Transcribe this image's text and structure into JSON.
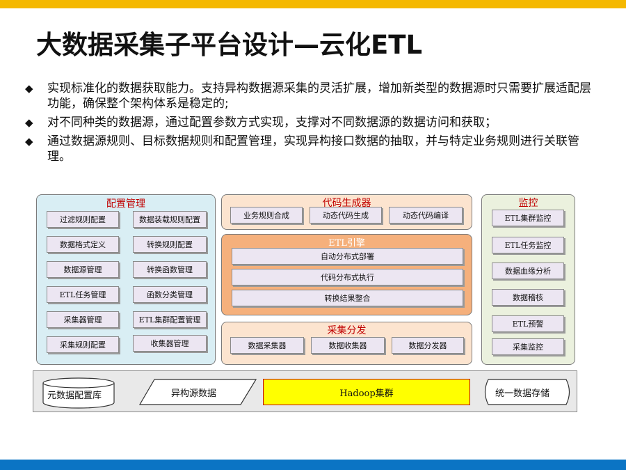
{
  "title": "大数据采集子平台设计—云化ETL",
  "bullets": [
    "实现标准化的数据获取能力。支持异构数据源采集的灵活扩展，增加新类型的数据源时只需要扩展适配层功能，确保整个架构体系是稳定的;",
    "对不同种类的数据源，通过配置参数方式实现，支撑对不同数据源的数据访问和获取；",
    "通过数据源规则、目标数据规则和配置管理，实现异构接口数据的抽取，并与特定业务规则进行关联管理。"
  ],
  "bullet_glyph": "◆",
  "diagram": {
    "config": {
      "title": "配置管理",
      "items": [
        "过滤规则配置",
        "数据装载规则配置",
        "数据格式定义",
        "转换规则配置",
        "数据源管理",
        "转换函数管理",
        "ETL任务管理",
        "函数分类管理",
        "采集器管理",
        "ETL集群配置管理",
        "采集规则配置",
        "收集器管理"
      ]
    },
    "codegen": {
      "title": "代码生成器",
      "items": [
        "业务规则合成",
        "动态代码生成",
        "动态代码编译"
      ]
    },
    "engine": {
      "title": "ETL引擎",
      "items": [
        "自动分布式部署",
        "代码分布式执行",
        "转换结果整合"
      ]
    },
    "collect": {
      "title": "采集分发",
      "items": [
        "数据采集器",
        "数据收集器",
        "数据分发器"
      ]
    },
    "monitor": {
      "title": "监控",
      "items": [
        "ETL集群监控",
        "ETL任务监控",
        "数据血缘分析",
        "数据稽核",
        "ETL预警",
        "采集监控"
      ]
    },
    "storage": {
      "meta_db": "元数据配置库",
      "hetero": "异构源数据",
      "hadoop": "Hadoop集群",
      "unified": "统一数据存储"
    }
  },
  "colors": {
    "top_bar": "#f5b800",
    "bottom_bar": "#0b74c4",
    "config_panel": "#d9eef4",
    "codegen_panel": "#fce4cf",
    "engine_panel": "#f5b07c",
    "collect_panel": "#fce4cf",
    "monitor_panel": "#ebf1de",
    "hadoop_fill": "#ffff00",
    "panel_title_red": "#c00000"
  }
}
